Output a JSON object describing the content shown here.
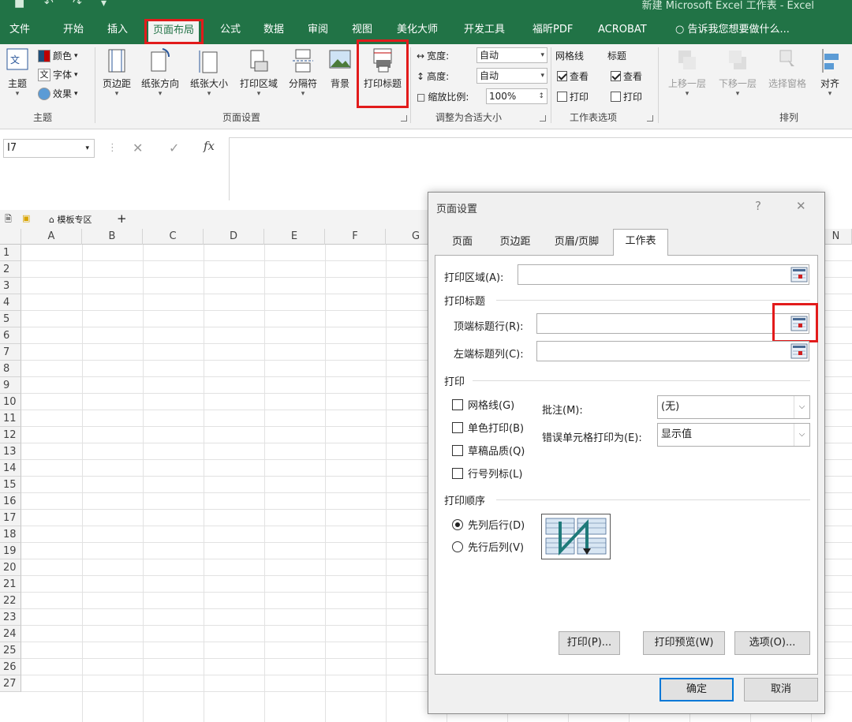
{
  "titlebar": {
    "title": "新建 Microsoft Excel 工作表 - Excel",
    "quick_access": [
      "save-icon",
      "undo-icon",
      "redo-icon",
      "customize-icon"
    ]
  },
  "tabs": [
    "文件",
    "开始",
    "插入",
    "页面布局",
    "公式",
    "数据",
    "审阅",
    "视图",
    "美化大师",
    "开发工具",
    "福昕PDF",
    "ACROBAT"
  ],
  "active_tab": "页面布局",
  "tell_me": "告诉我您想要做什么...",
  "ribbon": {
    "theme": {
      "main": "主题",
      "colors": "颜色",
      "fonts": "字体",
      "effects": "效果",
      "group": "主题"
    },
    "page_setup": {
      "margins": "页边距",
      "orientation": "纸张方向",
      "size": "纸张大小",
      "print_area": "打印区域",
      "breaks": "分隔符",
      "background": "背景",
      "print_titles": "打印标题",
      "group": "页面设置"
    },
    "scale": {
      "width_label": "宽度:",
      "width_value": "自动",
      "height_label": "高度:",
      "height_value": "自动",
      "scale_label": "缩放比例:",
      "scale_value": "100%",
      "group": "调整为合适大小"
    },
    "sheet_options": {
      "gridlines": "网格线",
      "headings": "标题",
      "view": "查看",
      "print": "打印",
      "group": "工作表选项",
      "gridlines_view": true,
      "gridlines_print": false,
      "headings_view": true,
      "headings_print": false
    },
    "arrange": {
      "bring_forward": "上移一层",
      "send_backward": "下移一层",
      "selection_pane": "选择窗格",
      "align": "对齐",
      "group": "排列"
    }
  },
  "formula_bar": {
    "name_box": "I7",
    "fx": "fx"
  },
  "sheet_strip": {
    "template_label": "模板专区",
    "add": "+"
  },
  "grid": {
    "columns": [
      "A",
      "B",
      "C",
      "D",
      "E",
      "F",
      "G",
      "N"
    ],
    "rows": [
      "1",
      "2",
      "3",
      "4",
      "5",
      "6",
      "7",
      "8",
      "9",
      "10",
      "11",
      "12",
      "13",
      "14",
      "15",
      "16",
      "17",
      "18",
      "19",
      "20",
      "21",
      "22",
      "23",
      "24",
      "25",
      "26",
      "27"
    ]
  },
  "dialog": {
    "title": "页面设置",
    "help": "?",
    "close": "✕",
    "tabs": [
      "页面",
      "页边距",
      "页眉/页脚",
      "工作表"
    ],
    "active_tab": "工作表",
    "print_area_label": "打印区域(A):",
    "print_titles_section": "打印标题",
    "rows_to_repeat_label": "顶端标题行(R):",
    "cols_to_repeat_label": "左端标题列(C):",
    "print_section": "打印",
    "checkboxes": [
      {
        "label": "网格线(G)",
        "checked": false
      },
      {
        "label": "单色打印(B)",
        "checked": false
      },
      {
        "label": "草稿品质(Q)",
        "checked": false
      },
      {
        "label": "行号列标(L)",
        "checked": false
      }
    ],
    "comments_label": "批注(M):",
    "comments_value": "(无)",
    "errors_label": "错误单元格打印为(E):",
    "errors_value": "显示值",
    "order_section": "打印顺序",
    "order_options": [
      {
        "label": "先列后行(D)",
        "selected": true
      },
      {
        "label": "先行后列(V)",
        "selected": false
      }
    ],
    "buttons": {
      "print": "打印(P)...",
      "preview": "打印预览(W)",
      "options": "选项(O)...",
      "ok": "确定",
      "cancel": "取消"
    }
  },
  "colors": {
    "excel_green": "#217346",
    "highlight_red": "#e21b1b",
    "focus_blue": "#0078d7"
  }
}
